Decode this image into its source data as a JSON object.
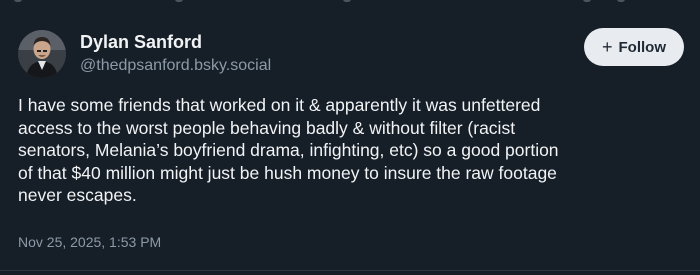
{
  "author": {
    "display_name": "Dylan Sanford",
    "handle": "@thedpsanford.bsky.social",
    "avatar_icon": "person-avatar-icon"
  },
  "follow_button": {
    "label": "Follow",
    "icon": "plus-icon"
  },
  "post": {
    "lines": [
      "I have some friends that worked on it & apparently it was unfettered",
      "access to the worst people behaving badly & without filter (racist",
      "senators, Melania’s boyfriend drama, infighting, etc) so a good portion",
      "of that $40 million might just be hush money to insure the raw footage",
      "never escapes."
    ],
    "timestamp": "Nov 25, 2025, 1:53 PM"
  },
  "colors": {
    "background": "#161e27",
    "text_primary": "#f1f3f5",
    "text_secondary": "#8d9aa8",
    "button_bg": "#e8ecf0",
    "button_text": "#1f2a36"
  }
}
